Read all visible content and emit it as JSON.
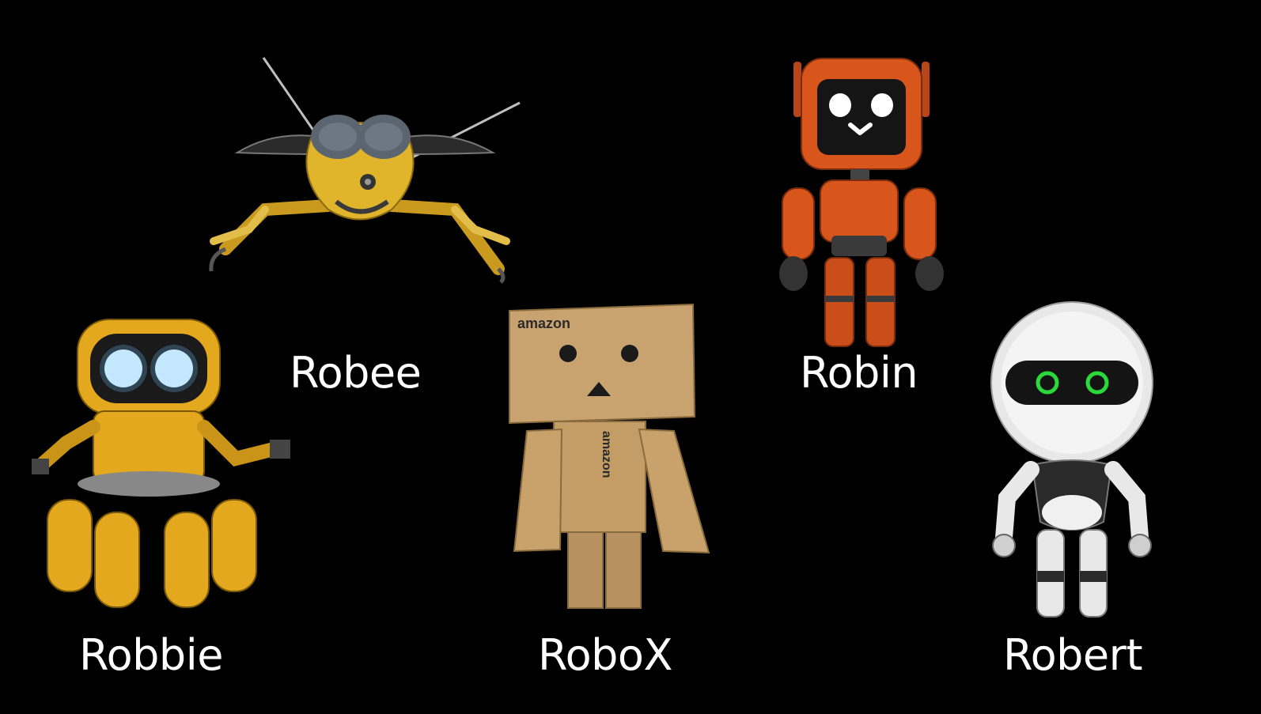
{
  "background_color": "#000000",
  "robots": [
    {
      "id": "robee",
      "label": "Robee",
      "type": "bee-robot",
      "color": "#e0b52b"
    },
    {
      "id": "robin",
      "label": "Robin",
      "type": "monitor-head-robot",
      "color": "#d8561c"
    },
    {
      "id": "robbie",
      "label": "Robbie",
      "type": "spider-robot",
      "color": "#e3a81d"
    },
    {
      "id": "robox",
      "label": "RoboX",
      "type": "cardboard-box-robot",
      "color": "#c9a36f",
      "print_head": "amazon",
      "print_body": "amazon"
    },
    {
      "id": "robert",
      "label": "Robert",
      "type": "white-astronaut-robot",
      "color": "#e8e8e8",
      "eye_color": "#2bd93a"
    }
  ]
}
